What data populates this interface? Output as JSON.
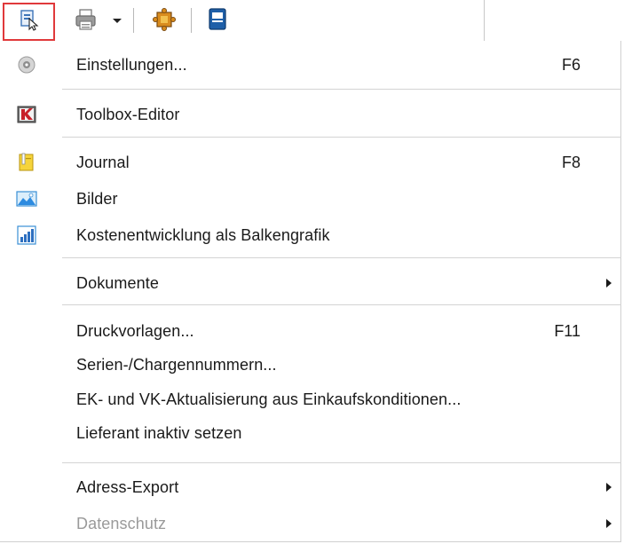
{
  "toolbar": {
    "buttons": [
      {
        "icon": "document-action-icon",
        "active": true
      },
      {
        "icon": "printer-icon",
        "has_dropdown": true
      },
      {
        "icon": "puzzle-icon"
      },
      {
        "icon": "blue-window-icon"
      }
    ],
    "accent_color": "#e0393b"
  },
  "menu": {
    "items": [
      {
        "id": "einstellungen",
        "label": "Einstellungen...",
        "shortcut": "F6",
        "icon": "settings-disc-icon"
      },
      {
        "id": "toolbox",
        "label": "Toolbox-Editor",
        "shortcut": "",
        "icon": "toolbox-icon"
      },
      {
        "id": "journal",
        "label": "Journal",
        "shortcut": "F8",
        "icon": "journal-note-icon"
      },
      {
        "id": "bilder",
        "label": "Bilder",
        "shortcut": "",
        "icon": "picture-icon"
      },
      {
        "id": "kosten",
        "label": "Kostenentwicklung als Balkengrafik",
        "shortcut": "",
        "icon": "bar-chart-icon"
      },
      {
        "id": "dokumente",
        "label": "Dokumente",
        "shortcut": "",
        "submenu": true
      },
      {
        "id": "druckvorlagen",
        "label": "Druckvorlagen...",
        "shortcut": "F11"
      },
      {
        "id": "serien",
        "label": "Serien-/Chargennummern...",
        "shortcut": ""
      },
      {
        "id": "ekvk",
        "label": "EK- und VK-Aktualisierung aus Einkaufskonditionen...",
        "shortcut": ""
      },
      {
        "id": "lieferant",
        "label": "Lieferant inaktiv setzen",
        "shortcut": ""
      },
      {
        "id": "adress",
        "label": "Adress-Export",
        "shortcut": "",
        "submenu": true
      },
      {
        "id": "datenschutz",
        "label": "Datenschutz",
        "shortcut": "",
        "submenu": true,
        "disabled": true
      }
    ]
  }
}
